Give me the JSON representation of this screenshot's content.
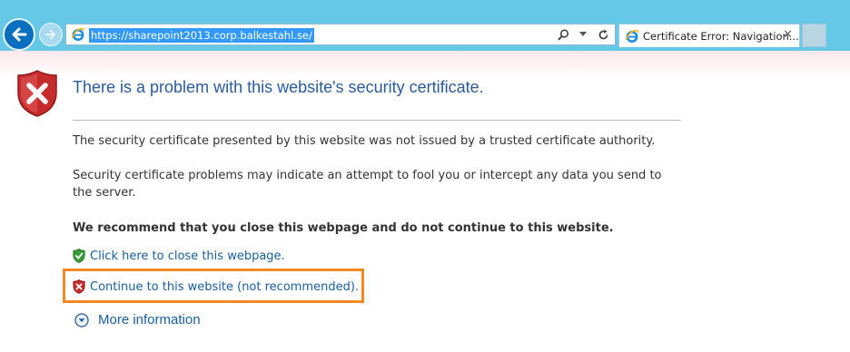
{
  "browser": {
    "address": {
      "url": "https://sharepoint2013.corp.balkestahl.se/"
    },
    "tab": {
      "title": "Certificate Error: Navigation...",
      "close_glyph": "✕"
    },
    "toolbar_icons": [
      "back-icon",
      "forward-icon",
      "ie-logo-icon",
      "search-icon",
      "dropdown-icon",
      "refresh-icon"
    ]
  },
  "page": {
    "headline": "There is a problem with this website's security certificate.",
    "paragraphs": [
      "The security certificate presented by this website was not issued by a trusted certificate authority.",
      "Security certificate problems may indicate an attempt to fool you or intercept any data you send to the server.",
      "We recommend that you close this webpage and do not continue to this website."
    ],
    "links": {
      "close": "Click here to close this webpage.",
      "continue": "Continue to this website (not recommended).",
      "more_info": "More information"
    },
    "colors": {
      "headline": "#2c5b9c",
      "link": "#1a5e9b",
      "highlight": "#f28a21",
      "chrome": "#64c8e6"
    }
  }
}
